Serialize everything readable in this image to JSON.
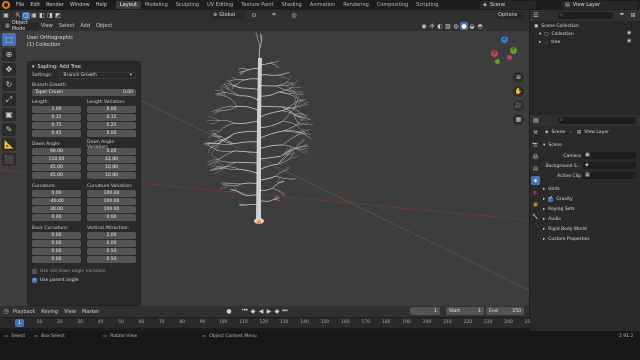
{
  "menu": [
    "File",
    "Edit",
    "Render",
    "Window",
    "Help"
  ],
  "workspaces": [
    "Layout",
    "Modeling",
    "Sculpting",
    "UV Editing",
    "Texture Paint",
    "Shading",
    "Animation",
    "Rendering",
    "Compositing",
    "Scripting"
  ],
  "active_workspace": "Layout",
  "scene_name": "Scene",
  "view_layer_name": "View Layer",
  "viewport": {
    "mode": "Object Mode",
    "menus": [
      "View",
      "Select",
      "Add",
      "Object"
    ],
    "orientation": "Global",
    "options_label": "Options",
    "view_name": "User Orthographic",
    "collection_name": "(1) Collection"
  },
  "gizmo": {
    "x": "X",
    "y": "Y",
    "z": "Z"
  },
  "operator_panel": {
    "title": "Sapling: Add Tree",
    "settings_label": "Settings:",
    "settings_value": "Branch Growth",
    "branch_growth_header": "Branch Growth:",
    "taper_label": "Taper Crown",
    "taper_value": "0.00",
    "length_label": "Length:",
    "length_values": [
      "1.00",
      "0.32",
      "0.75",
      "0.45"
    ],
    "length_var_label": "Length Variation:",
    "length_var_values": [
      "0.00",
      "0.15",
      "0.25",
      "0.00"
    ],
    "down_angle_label": "Down Angle:",
    "down_angle_values": [
      "90.00",
      "110.00",
      "45.00",
      "45.00"
    ],
    "down_angle_var_label": "Down Angle Variation:",
    "down_angle_var_values": [
      "0.00",
      "42.00",
      "10.00",
      "10.00"
    ],
    "curvature_label": "Curvature:",
    "curvature_values": [
      "0.00",
      "-40.00",
      "30.00",
      "0.00"
    ],
    "curvature_var_label": "Curvature Variation:",
    "curvature_var_values": [
      "100.00",
      "100.00",
      "100.00",
      "0.00"
    ],
    "back_curvature_label": "Back Curvature:",
    "back_curvature_values": [
      "0.00",
      "0.00",
      "0.00",
      "0.00"
    ],
    "vertical_attraction_label": "Vertical Attraction:",
    "vertical_attraction_values": [
      "2.00",
      "0.00",
      "0.50",
      "0.50"
    ],
    "old_down_angle_label": "Use old down angle variation",
    "old_down_angle_checked": false,
    "parent_angle_label": "Use parent angle",
    "parent_angle_checked": true
  },
  "timeline": {
    "menus": [
      "Playback",
      "Keying",
      "View",
      "Marker"
    ],
    "current_frame": "1",
    "start_label": "Start",
    "start_value": "1",
    "end_label": "End",
    "end_value": "250",
    "ticks": [
      "1",
      "10",
      "20",
      "30",
      "40",
      "50",
      "60",
      "70",
      "80",
      "90",
      "100",
      "110",
      "120",
      "130",
      "140",
      "150",
      "160",
      "170",
      "180",
      "190",
      "200",
      "210",
      "220",
      "230",
      "240",
      "250"
    ]
  },
  "statusbar": {
    "select": "Select",
    "box_select": "Box Select",
    "rotate_view": "Rotate View",
    "context_menu": "Object Context Menu",
    "version": "2.91.2"
  },
  "outliner": {
    "scene_collection": "Scene Collection",
    "collection": "Collection",
    "tree": "tree"
  },
  "properties": {
    "breadcrumb_scene": "Scene",
    "breadcrumb_view_layer": "View Layer",
    "scene_header": "Scene",
    "camera_label": "Camera",
    "background_label": "Background S...",
    "active_clip_label": "Active Clip",
    "units_label": "Units",
    "gravity_label": "Gravity",
    "gravity_checked": true,
    "keying_sets_label": "Keying Sets",
    "audio_label": "Audio",
    "rigid_body_label": "Rigid Body World",
    "custom_props_label": "Custom Properties"
  },
  "colors": {
    "accent": "#4772b3",
    "viewport_bg": "#3d3d3d",
    "panel_bg": "#2a2a2a",
    "x_axis": "#c94151",
    "y_axis": "#6b9a2a",
    "z_axis": "#3a7bd5"
  }
}
